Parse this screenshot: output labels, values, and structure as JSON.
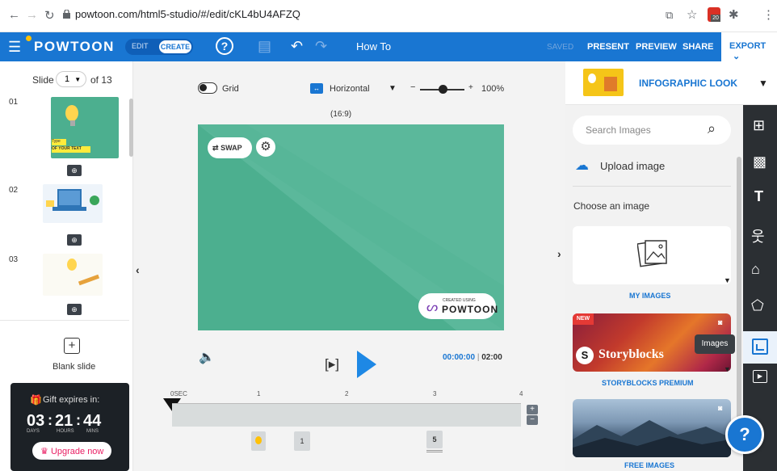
{
  "browser": {
    "url": "powtoon.com/html5-studio/#/edit/cKL4bU4AFZQ",
    "ext_badge": "20"
  },
  "header": {
    "logo": "POWTOON",
    "mode_edit": "EDIT",
    "mode_create": "CREATE",
    "title": "How To",
    "saved": "SAVED",
    "present": "PRESENT",
    "preview": "PREVIEW",
    "share": "SHARE",
    "export": "EXPORT"
  },
  "slides": {
    "label": "Slide",
    "current": "1",
    "total_label": "of 13",
    "items": [
      {
        "number": "01",
        "text1": "Type",
        "text2": "OF YOUR TEXT"
      },
      {
        "number": "02"
      },
      {
        "number": "03"
      }
    ],
    "blank_slide": "Blank slide"
  },
  "gift": {
    "title": "Gift expires in:",
    "days": "03",
    "hours": "21",
    "mins": "44",
    "days_label": "DAYS",
    "hours_label": "HOURS",
    "mins_label": "MINS",
    "upgrade": "Upgrade now"
  },
  "canvas_toolbar": {
    "grid_label": "Grid",
    "orientation": "Horizontal",
    "zoom": "100%",
    "aspect": "(16:9)",
    "zoom_level": 0.5
  },
  "stage": {
    "swap": "SWAP",
    "watermark_small": "CREATED USING",
    "watermark_brand": "POWTOON"
  },
  "playback": {
    "current_time": "00:00:00",
    "duration": "02:00"
  },
  "timeline": {
    "start_label": "0SEC",
    "ticks": [
      "1",
      "2",
      "3",
      "4"
    ],
    "markers": [
      "1",
      "5"
    ]
  },
  "right_panel": {
    "style_title": "INFOGRAPHIC LOOK",
    "search_placeholder": "Search Images",
    "upload": "Upload image",
    "choose": "Choose an image",
    "my_images": "MY IMAGES",
    "new_badge": "NEW",
    "storyblocks": "Storyblocks",
    "storyblocks_label": "STORYBLOCKS PREMIUM",
    "free_images": "FREE IMAGES",
    "tooltip": "Images"
  },
  "colors": {
    "brand_blue": "#1976d2",
    "stage_green": "#4caf8f",
    "dark": "#2b2f33",
    "upgrade_pink": "#e91e63"
  }
}
